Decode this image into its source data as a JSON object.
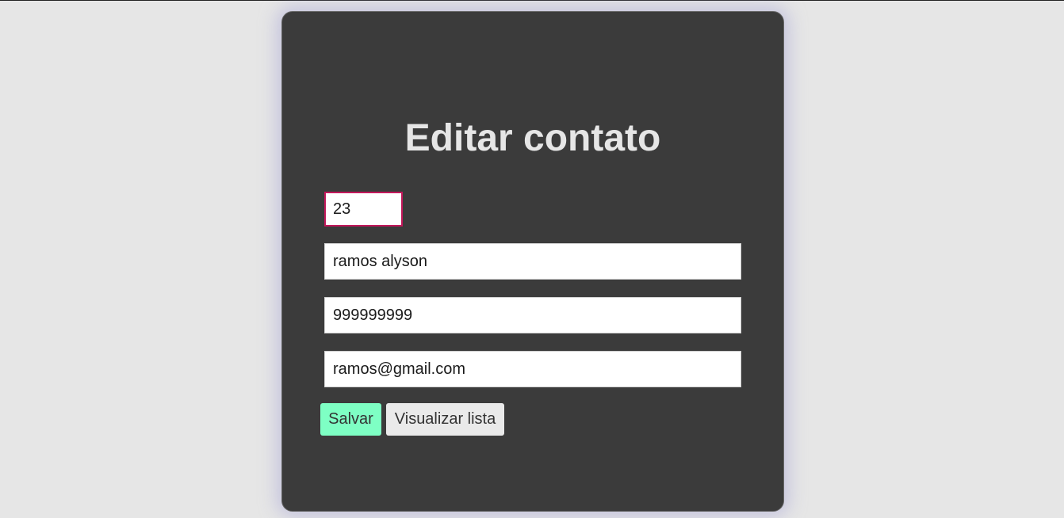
{
  "form": {
    "title": "Editar contato",
    "id_value": "23",
    "name_value": "ramos alyson",
    "phone_value": "999999999",
    "email_value": "ramos@gmail.com"
  },
  "buttons": {
    "save_label": "Salvar",
    "list_label": "Visualizar lista"
  },
  "colors": {
    "background": "#e6e6e6",
    "card": "#3b3b3b",
    "save_button": "#7effc4",
    "list_button": "#eaeaea",
    "focused_border": "#c2185b"
  }
}
